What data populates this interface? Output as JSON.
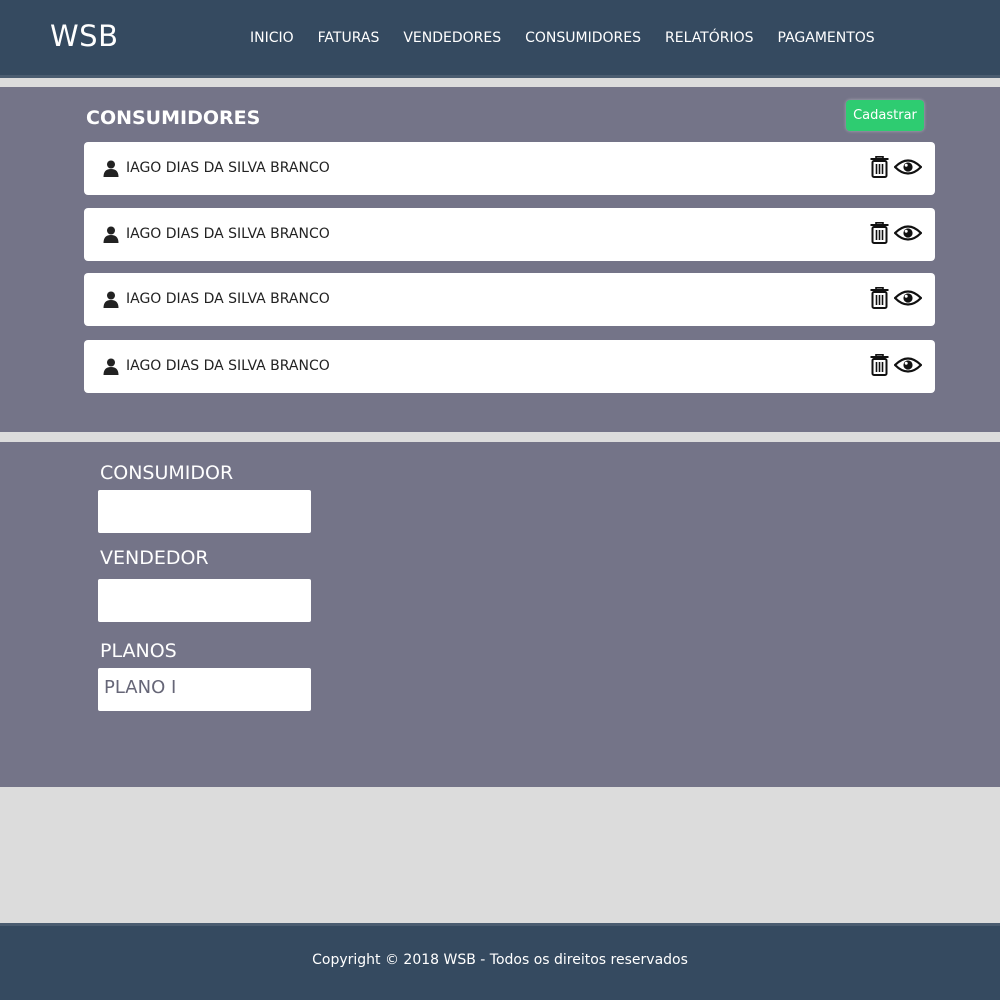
{
  "navbar": {
    "brand": "WSB",
    "links": [
      "INICIO",
      "FATURAS",
      "VENDEDORES",
      "CONSUMIDORES",
      "RELATÓRIOS",
      "PAGAMENTOS"
    ]
  },
  "consumers_section": {
    "title": "CONSUMIDORES",
    "add_button_label": "Cadastrar",
    "items": [
      {
        "name": "IAGO DIAS DA SILVA BRANCO"
      },
      {
        "name": "IAGO DIAS DA SILVA BRANCO"
      },
      {
        "name": "IAGO DIAS DA SILVA BRANCO"
      },
      {
        "name": "IAGO DIAS DA SILVA BRANCO"
      }
    ]
  },
  "form": {
    "consumer_label": "CONSUMIDOR",
    "consumer_value": "",
    "seller_label": "VENDEDOR",
    "seller_value": "",
    "plans_label": "PLANOS",
    "plans_selected": "PLANO I"
  },
  "footer": {
    "text": "Copyright © 2018 WSB - Todos os direitos reservados"
  },
  "colors": {
    "navbar_bg": "#354a60",
    "section_bg": "#747488",
    "page_bg": "#dcdcdc",
    "accent_green": "#2ecc71"
  },
  "icons": [
    "user-icon",
    "trash-icon",
    "eye-icon"
  ]
}
